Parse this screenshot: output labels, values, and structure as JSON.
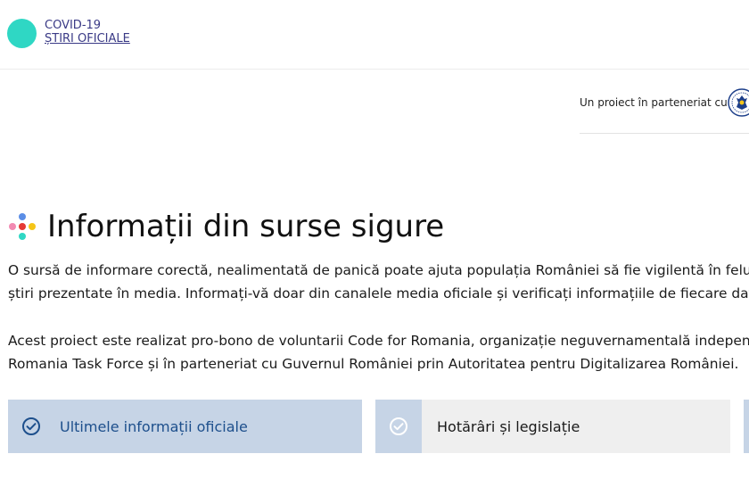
{
  "header": {
    "logo_line1": "COVID-19",
    "logo_line2": "ȘTIRI OFICIALE",
    "logo_color": "#2fd7c4"
  },
  "partner": {
    "text": "Un proiect în parteneriat cu",
    "seal_icon": "romanian-government-seal-icon"
  },
  "main": {
    "title": "Informații din surse sigure",
    "paragraph1_line1": "O sursă de informare corectă, nealimentată de panică poate ajuta populația României să fie vigilentă în felul în care",
    "paragraph1_line2": "știri prezentate în media. Informați-vă doar din canalele media oficiale și verificați informațiile de fiecare dată.",
    "paragraph2_line1": "Acest proiect este realizat pro-bono de voluntarii Code for Romania, organizație neguvernamentală independentă, ne",
    "paragraph2_line2": "Romania Task Force și în parteneriat cu Guvernul României prin Autoritatea pentru Digitalizarea României."
  },
  "tabs": [
    {
      "label": "Ultimele informații oficiale",
      "active": true,
      "icon": "check-circle-icon"
    },
    {
      "label": "Hotărâri și legislație",
      "active": false,
      "icon": "check-circle-icon"
    }
  ],
  "colors": {
    "accent": "#1d4f8c",
    "tab_active_bg": "#c6d4e6",
    "tab_inactive_bg": "#efefef",
    "dot_colors": [
      "#f28ab2",
      "#e53935",
      "#f5c518",
      "#2fd7c4",
      "#5b8ee6"
    ]
  }
}
